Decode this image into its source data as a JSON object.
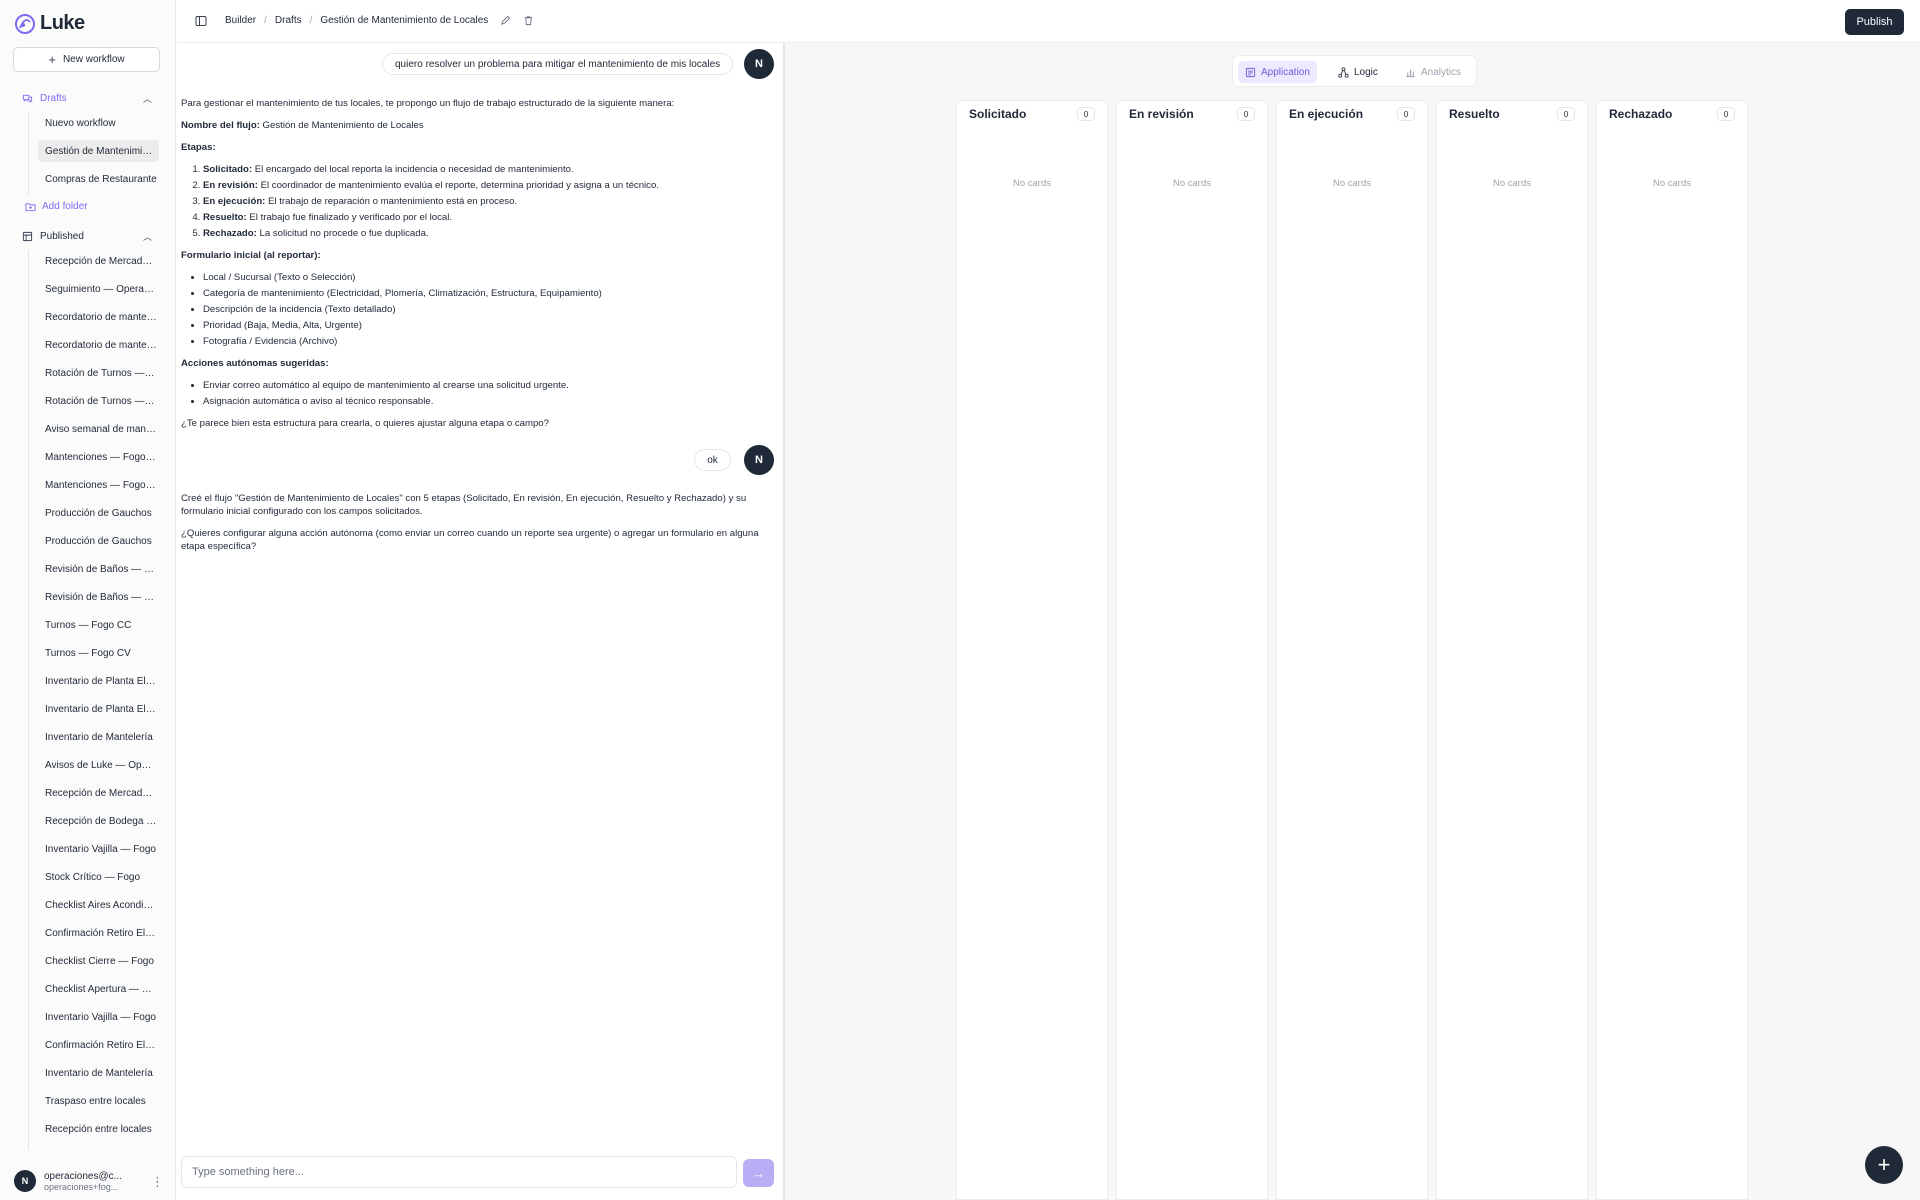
{
  "app": {
    "logo_text": "Luke"
  },
  "sidebar": {
    "new_workflow": "New workflow",
    "drafts_label": "Drafts",
    "drafts": [
      "Nuevo workflow",
      "Gestión de Mantenimiento de Locales",
      "Compras de Restaurante"
    ],
    "add_folder": "Add folder",
    "published_label": "Published",
    "published": [
      "Recepción de Mercadería",
      "Seguimiento — Operaciones",
      "Recordatorio de mantención",
      "Recordatorio de mantención",
      "Rotación de Turnos — Fogo",
      "Rotación de Turnos — Fogo",
      "Aviso semanal de mantención",
      "Mantenciones — Fogo CC",
      "Mantenciones — Fogo CV",
      "Producción de Gauchos",
      "Producción de Gauchos",
      "Revisión de Baños — Fogo",
      "Revisión de Baños — Fogo",
      "Turnos — Fogo CC",
      "Turnos — Fogo CV",
      "Inventario de Planta El Golf",
      "Inventario de Planta El Golf",
      "Inventario de Mantelería",
      "Avisos de Luke — Operaciones",
      "Recepción de Mercadería",
      "Recepción de Bodega Central",
      "Inventario Vajilla — Fogo",
      "Stock Crítico — Fogo",
      "Checklist Aires Acondicionados",
      "Confirmación Retiro El Golf",
      "Checklist Cierre — Fogo",
      "Checklist Apertura — Fogo",
      "Inventario Vajilla — Fogo",
      "Confirmación Retiro El Golf",
      "Inventario de Mantelería",
      "Traspaso entre locales",
      "Recepción entre locales"
    ],
    "user": {
      "initial": "N",
      "email": "operaciones@c...",
      "email2": "operaciones+fog..."
    }
  },
  "header": {
    "breadcrumb": [
      "Builder",
      "Drafts",
      "Gestión de Mantenimiento de Locales"
    ],
    "publish": "Publish"
  },
  "chat": {
    "user_msg_1": "quiero resolver un problema para mitigar el mantenimiento de mis locales",
    "user_msg_2": "ok",
    "user_initial": "N",
    "intro": "Para gestionar el mantenimiento de tus locales, te propongo un flujo de trabajo estructurado de la siguiente manera:",
    "flow_name_label": "Nombre del flujo:",
    "flow_name": " Gestión de Mantenimiento de Locales",
    "stages_label": "Etapas:",
    "stages": [
      {
        "name": "Solicitado:",
        "desc": " El encargado del local reporta la incidencia o necesidad de mantenimiento."
      },
      {
        "name": "En revisión:",
        "desc": " El coordinador de mantenimiento evalúa el reporte, determina prioridad y asigna a un técnico."
      },
      {
        "name": "En ejecución:",
        "desc": " El trabajo de reparación o mantenimiento está en proceso."
      },
      {
        "name": "Resuelto:",
        "desc": " El trabajo fue finalizado y verificado por el local."
      },
      {
        "name": "Rechazado:",
        "desc": " La solicitud no procede o fue duplicada."
      }
    ],
    "form_label": "Formulario inicial (al reportar):",
    "form_fields": [
      "Local / Sucursal (Texto o Selección)",
      "Categoría de mantenimiento (Electricidad, Plomería, Climatización, Estructura, Equipamiento)",
      "Descripción de la incidencia (Texto detallado)",
      "Prioridad (Baja, Media, Alta, Urgente)",
      "Fotografía / Evidencia (Archivo)"
    ],
    "actions_label": "Acciones autónomas sugeridas:",
    "actions": [
      "Enviar correo automático al equipo de mantenimiento al crearse una solicitud urgente.",
      "Asignación automática o aviso al técnico responsable."
    ],
    "question": "¿Te parece bien esta estructura para crearla, o quieres ajustar alguna etapa o campo?",
    "reply_1": "Creé el flujo \"Gestión de Mantenimiento de Locales\" con 5 etapas (Solicitado, En revisión, En ejecución, Resuelto y Rechazado) y su formulario inicial configurado con los campos solicitados.",
    "reply_2": "¿Quieres configurar alguna acción autónoma (como enviar un correo cuando un reporte sea urgente) o agregar un formulario en alguna etapa específica?",
    "input_placeholder": "Type something here..."
  },
  "board": {
    "tabs": [
      "Application",
      "Logic",
      "Analytics"
    ],
    "columns": [
      {
        "title": "Solicitado",
        "count": "0",
        "empty": "No cards"
      },
      {
        "title": "En revisión",
        "count": "0",
        "empty": "No cards"
      },
      {
        "title": "En ejecución",
        "count": "0",
        "empty": "No cards"
      },
      {
        "title": "Resuelto",
        "count": "0",
        "empty": "No cards"
      },
      {
        "title": "Rechazado",
        "count": "0",
        "empty": "No cards"
      }
    ]
  },
  "colors": {
    "accent": "#7c6cf0",
    "dark": "#1f2937"
  }
}
